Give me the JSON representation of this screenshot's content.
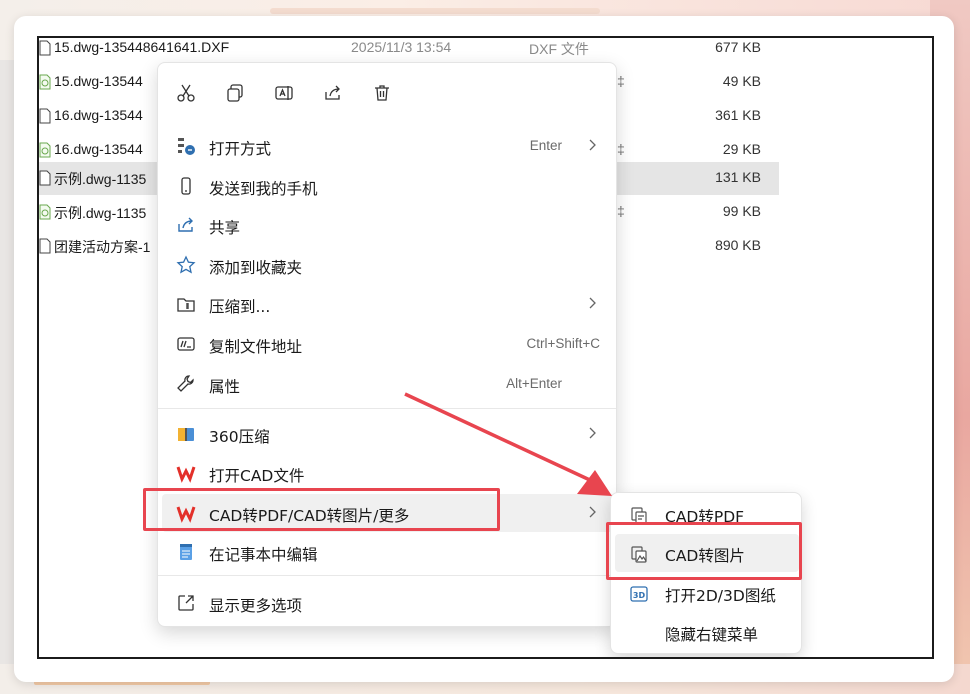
{
  "colors": {
    "accent_red": "#e8454f",
    "wps_red": "#e3302a",
    "icon_blue": "#2f6fb0",
    "selected_row": "#e5e5e5"
  },
  "files": [
    {
      "name": "15.dwg-1354486416​41.DXF",
      "date": "2025/11/3 13:54",
      "type": "DXF 文件",
      "size": "677 KB",
      "icon": "file-icon",
      "selected": false
    },
    {
      "name": "15.dwg-13544",
      "date": "",
      "type": "‡",
      "size": "49 KB",
      "icon": "dwg-icon",
      "selected": false
    },
    {
      "name": "16.dwg-13544",
      "date": "",
      "type": "",
      "size": "361 KB",
      "icon": "file-icon",
      "selected": false
    },
    {
      "name": "16.dwg-13544",
      "date": "",
      "type": "‡",
      "size": "29 KB",
      "icon": "dwg-icon",
      "selected": false
    },
    {
      "name": "示例.dwg-1135",
      "date": "",
      "type": "",
      "size": "131 KB",
      "icon": "file-icon",
      "selected": true
    },
    {
      "name": "示例.dwg-1135",
      "date": "",
      "type": "‡",
      "size": "99 KB",
      "icon": "dwg-icon",
      "selected": false
    },
    {
      "name": "团建活动方案-1",
      "date": "",
      "type": "",
      "size": "890 KB",
      "icon": "file-icon",
      "selected": false
    }
  ],
  "quickbar": [
    {
      "icon": "cut-icon"
    },
    {
      "icon": "copy-icon"
    },
    {
      "icon": "rename-icon"
    },
    {
      "icon": "share-icon"
    },
    {
      "icon": "delete-icon"
    }
  ],
  "menu": {
    "items": [
      {
        "label": "打开方式",
        "shortcut": "Enter",
        "has_arrow": true,
        "icon": "open-with-icon"
      },
      {
        "label": "发送到我的手机",
        "shortcut": "",
        "has_arrow": false,
        "icon": "phone-icon"
      },
      {
        "label": "共享",
        "shortcut": "",
        "has_arrow": false,
        "icon": "share-icon"
      },
      {
        "label": "添加到收藏夹",
        "shortcut": "",
        "has_arrow": false,
        "icon": "star-icon"
      },
      {
        "label": "压缩到...",
        "shortcut": "",
        "has_arrow": true,
        "icon": "zip-icon"
      },
      {
        "label": "复制文件地址",
        "shortcut": "Ctrl+Shift+C",
        "has_arrow": false,
        "icon": "copy-path-icon"
      },
      {
        "label": "属性",
        "shortcut": "Alt+Enter",
        "has_arrow": false,
        "icon": "wrench-icon"
      },
      {
        "label": "360压缩",
        "shortcut": "",
        "has_arrow": true,
        "icon": "360-zip-icon"
      },
      {
        "label": "打开CAD文件",
        "shortcut": "",
        "has_arrow": false,
        "icon": "wps-icon"
      },
      {
        "label": "CAD转PDF/CAD转图片/更多",
        "shortcut": "",
        "has_arrow": true,
        "icon": "wps-icon"
      },
      {
        "label": "在记事本中编辑",
        "shortcut": "",
        "has_arrow": false,
        "icon": "notepad-icon"
      },
      {
        "label": "显示更多选项",
        "shortcut": "",
        "has_arrow": false,
        "icon": "more-options-icon"
      }
    ]
  },
  "submenu": {
    "items": [
      {
        "label": "CAD转PDF",
        "icon": "cad-pdf-icon"
      },
      {
        "label": "CAD转图片",
        "icon": "cad-image-icon"
      },
      {
        "label": "打开2D/3D图纸",
        "icon": "3d-icon"
      },
      {
        "label": "隐藏右键菜单",
        "icon": ""
      }
    ]
  }
}
